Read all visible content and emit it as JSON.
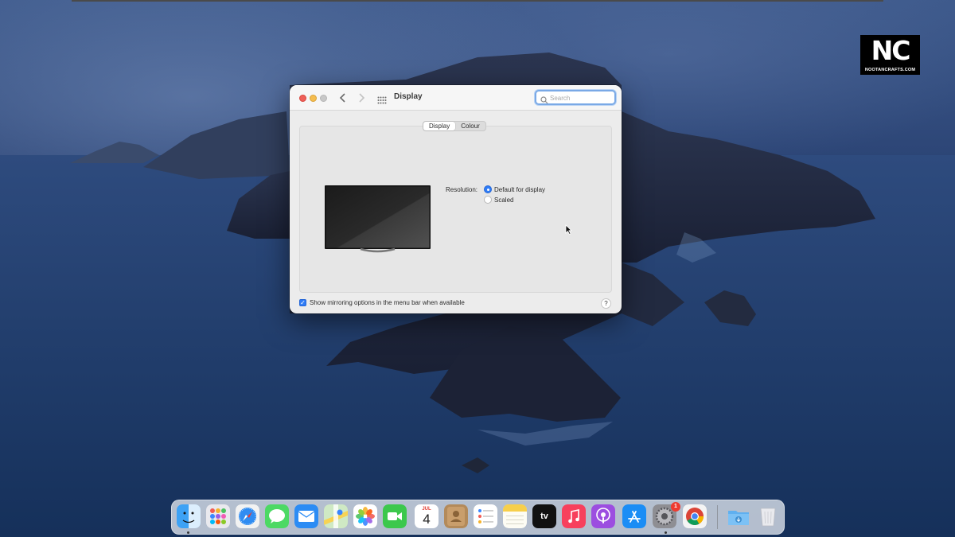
{
  "branding": {
    "logo_mark": "NC",
    "logo_site": "NOOTANCRAFTS.COM"
  },
  "window": {
    "title": "Display",
    "search_placeholder": "Search",
    "tabs": [
      {
        "label": "Display",
        "active": true
      },
      {
        "label": "Colour",
        "active": false
      }
    ],
    "resolution_label": "Resolution:",
    "resolution_options": [
      {
        "label": "Default for display",
        "selected": true
      },
      {
        "label": "Scaled",
        "selected": false
      }
    ],
    "mirroring_label": "Show mirroring options in the menu bar when available",
    "mirroring_checked": true,
    "help_label": "?"
  },
  "dock": {
    "apps": [
      {
        "name": "Finder",
        "icon": "finder-icon",
        "running": true
      },
      {
        "name": "Launchpad",
        "icon": "launchpad-icon"
      },
      {
        "name": "Safari",
        "icon": "safari-icon"
      },
      {
        "name": "Messages",
        "icon": "messages-icon"
      },
      {
        "name": "Mail",
        "icon": "mail-icon"
      },
      {
        "name": "Maps",
        "icon": "maps-icon"
      },
      {
        "name": "Photos",
        "icon": "photos-icon"
      },
      {
        "name": "FaceTime",
        "icon": "facetime-icon"
      },
      {
        "name": "Calendar",
        "icon": "calendar-icon",
        "month": "JUL",
        "day": "4"
      },
      {
        "name": "Contacts",
        "icon": "contacts-icon"
      },
      {
        "name": "Reminders",
        "icon": "reminders-icon"
      },
      {
        "name": "Notes",
        "icon": "notes-icon"
      },
      {
        "name": "TV",
        "icon": "tv-icon",
        "text": "tv"
      },
      {
        "name": "Music",
        "icon": "music-icon"
      },
      {
        "name": "Podcasts",
        "icon": "podcasts-icon"
      },
      {
        "name": "App Store",
        "icon": "app-store-icon"
      },
      {
        "name": "System Preferences",
        "icon": "system-preferences-icon",
        "running": true,
        "badge": "1"
      },
      {
        "name": "Chrome",
        "icon": "chrome-icon"
      },
      {
        "name": "Downloads",
        "icon": "downloads-folder-icon"
      },
      {
        "name": "Trash",
        "icon": "trash-icon"
      }
    ]
  },
  "colors": {
    "accent": "#2f7cf6",
    "close": "#ee5f58",
    "minimize": "#f5bd4f",
    "badge": "#ee3b30"
  }
}
